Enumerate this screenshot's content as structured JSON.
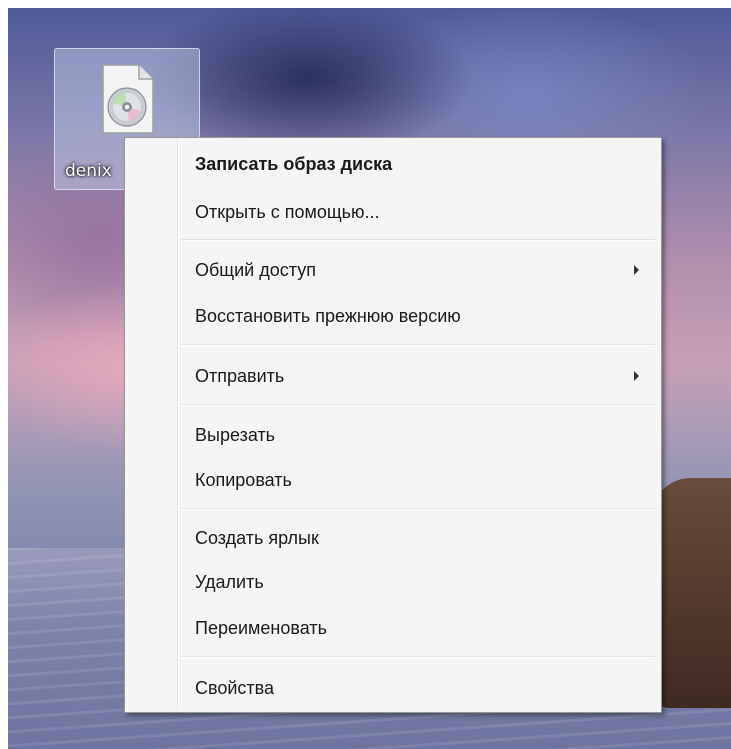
{
  "desktop": {
    "icon_label": "denix"
  },
  "context_menu": {
    "items": [
      {
        "label": "Записать образ диска",
        "bold": true
      },
      {
        "label": "Открыть с помощью..."
      },
      {
        "label": "Общий доступ",
        "submenu": true
      },
      {
        "label": "Восстановить прежнюю версию"
      },
      {
        "label": "Отправить",
        "submenu": true
      },
      {
        "label": "Вырезать"
      },
      {
        "label": "Копировать"
      },
      {
        "label": "Создать ярлык"
      },
      {
        "label": "Удалить"
      },
      {
        "label": "Переименовать"
      },
      {
        "label": "Свойства"
      }
    ]
  }
}
